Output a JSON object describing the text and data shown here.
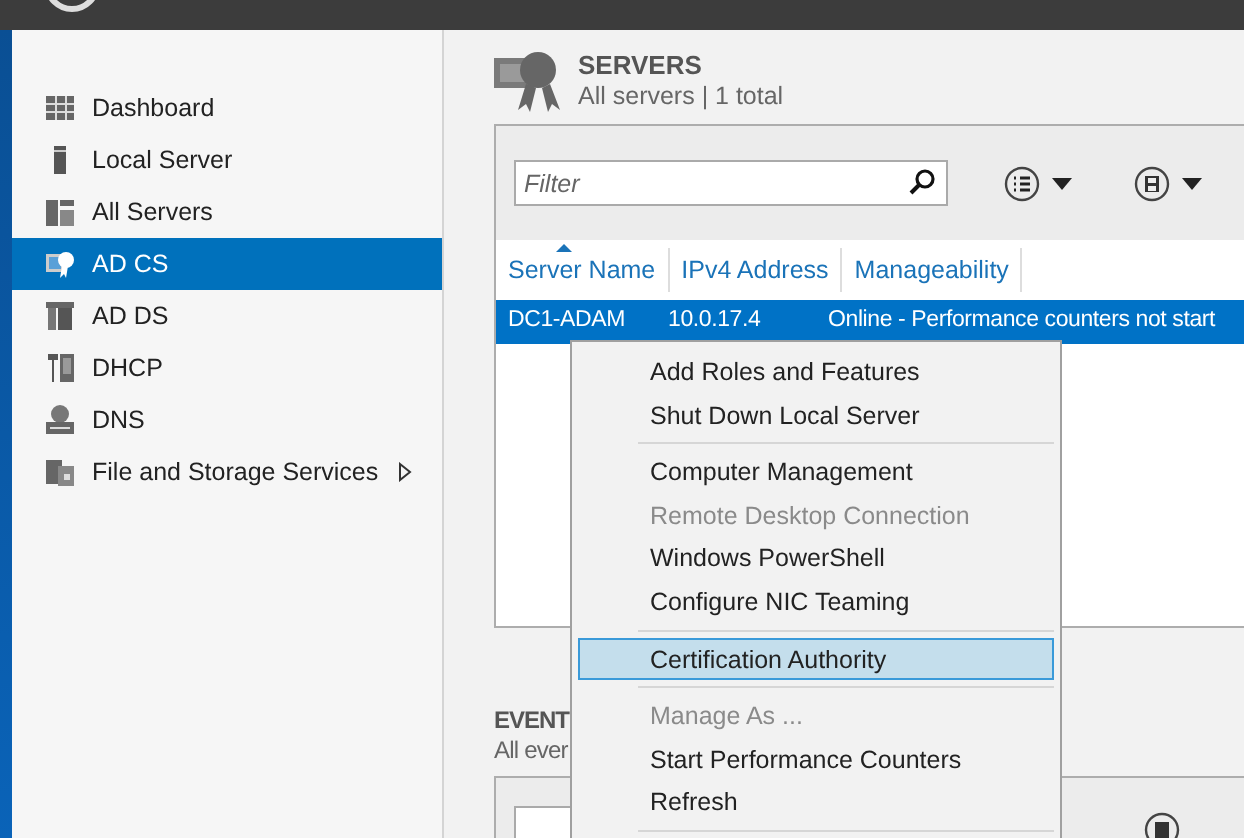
{
  "sidebar": {
    "items": [
      {
        "label": "Dashboard",
        "selected": false,
        "has_submenu": false
      },
      {
        "label": "Local Server",
        "selected": false,
        "has_submenu": false
      },
      {
        "label": "All Servers",
        "selected": false,
        "has_submenu": false
      },
      {
        "label": "AD CS",
        "selected": true,
        "has_submenu": false
      },
      {
        "label": "AD DS",
        "selected": false,
        "has_submenu": false
      },
      {
        "label": "DHCP",
        "selected": false,
        "has_submenu": false
      },
      {
        "label": "DNS",
        "selected": false,
        "has_submenu": false
      },
      {
        "label": "File and Storage Services",
        "selected": false,
        "has_submenu": true
      }
    ]
  },
  "servers": {
    "title": "SERVERS",
    "subtitle": "All servers | 1 total",
    "filter": {
      "placeholder": "Filter"
    },
    "columns": [
      {
        "label": "Server Name",
        "sorted": true
      },
      {
        "label": "IPv4 Address",
        "sorted": false
      },
      {
        "label": "Manageability",
        "sorted": false
      }
    ],
    "rows": [
      {
        "selected": true,
        "cells": [
          "DC1-ADAM",
          "10.0.17.4",
          "Online - Performance counters not start"
        ]
      }
    ]
  },
  "events": {
    "title": "EVENT",
    "subtitle": "All ever"
  },
  "context_menu": {
    "items": [
      {
        "kind": "item",
        "label": "Add Roles and Features",
        "disabled": false,
        "highlighted": false
      },
      {
        "kind": "item",
        "label": "Shut Down Local Server",
        "disabled": false,
        "highlighted": false
      },
      {
        "kind": "separator"
      },
      {
        "kind": "item",
        "label": "Computer Management",
        "disabled": false,
        "highlighted": false
      },
      {
        "kind": "item",
        "label": "Remote Desktop Connection",
        "disabled": true,
        "highlighted": false
      },
      {
        "kind": "item",
        "label": "Windows PowerShell",
        "disabled": false,
        "highlighted": false
      },
      {
        "kind": "item",
        "label": "Configure NIC Teaming",
        "disabled": false,
        "highlighted": false
      },
      {
        "kind": "separator"
      },
      {
        "kind": "item",
        "label": "Certification Authority",
        "disabled": false,
        "highlighted": true
      },
      {
        "kind": "separator"
      },
      {
        "kind": "item",
        "label": "Manage As ...",
        "disabled": true,
        "highlighted": false
      },
      {
        "kind": "item",
        "label": "Start Performance Counters",
        "disabled": false,
        "highlighted": false
      },
      {
        "kind": "item",
        "label": "Refresh",
        "disabled": false,
        "highlighted": false
      },
      {
        "kind": "separator"
      }
    ]
  }
}
